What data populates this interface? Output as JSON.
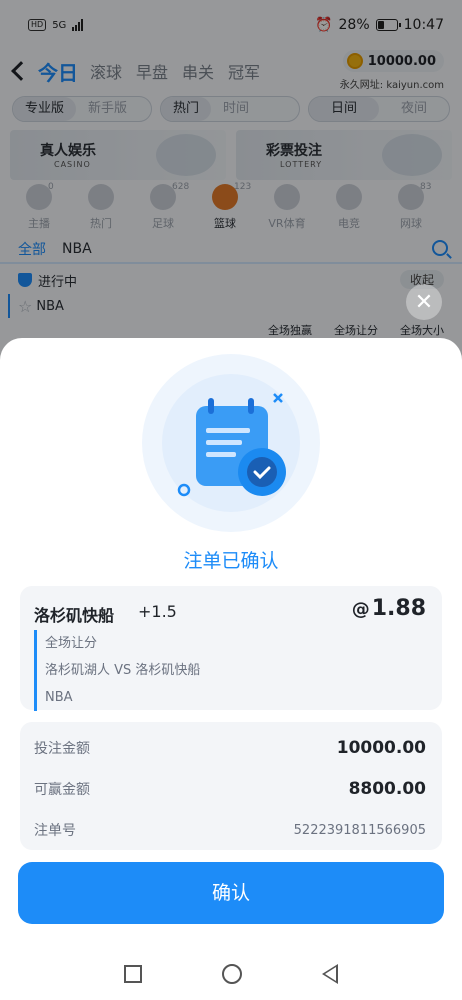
{
  "status_bar": {
    "network": "5G",
    "battery_percent": "28%",
    "time": "10:47"
  },
  "header": {
    "title": "今日",
    "tabs": [
      "滚球",
      "早盘",
      "串关",
      "冠军"
    ],
    "balance": "10000.00",
    "site_url": "永久网址: kaiyun.com"
  },
  "toggles": {
    "version": [
      "专业版",
      "新手版"
    ],
    "sort": [
      "热门",
      "时间"
    ],
    "theme": [
      "日间",
      "夜间"
    ]
  },
  "banners": [
    {
      "title": "真人娱乐",
      "subtitle": "CASINO"
    },
    {
      "title": "彩票投注",
      "subtitle": "LOTTERY"
    }
  ],
  "categories": [
    {
      "label": "主播",
      "count": "0",
      "icon": "microphone-icon"
    },
    {
      "label": "热门",
      "count": "",
      "icon": "flame-icon"
    },
    {
      "label": "足球",
      "count": "628",
      "icon": "soccer-icon"
    },
    {
      "label": "篮球",
      "count": "123",
      "icon": "basketball-icon"
    },
    {
      "label": "VR体育",
      "count": "",
      "icon": "vr-icon"
    },
    {
      "label": "电竞",
      "count": "",
      "icon": "gamepad-icon"
    },
    {
      "label": "网球",
      "count": "83",
      "icon": "tennis-icon"
    }
  ],
  "filter": {
    "all": "全部",
    "league": "NBA"
  },
  "inplay": {
    "label": "进行中",
    "collapse": "收起"
  },
  "league_row": {
    "name": "NBA"
  },
  "markets": [
    "全场独赢",
    "全场让分",
    "全场大小"
  ],
  "sheet": {
    "title": "注单已确认",
    "bet": {
      "selection": "洛杉矶快船",
      "handicap": "+1.5",
      "odds_prefix": "@",
      "odds": "1.88",
      "market": "全场让分",
      "match": "洛杉矶湖人 VS 洛杉矶快船",
      "league": "NBA"
    },
    "summary": {
      "stake_label": "投注金额",
      "stake": "10000.00",
      "payout_label": "可赢金额",
      "payout": "8800.00",
      "ticket_label": "注单号",
      "ticket": "5222391811566905"
    },
    "confirm": "确认"
  },
  "colors": {
    "accent": "#1d8cf8",
    "overlay": "rgba(0,0,0,0.38)"
  }
}
